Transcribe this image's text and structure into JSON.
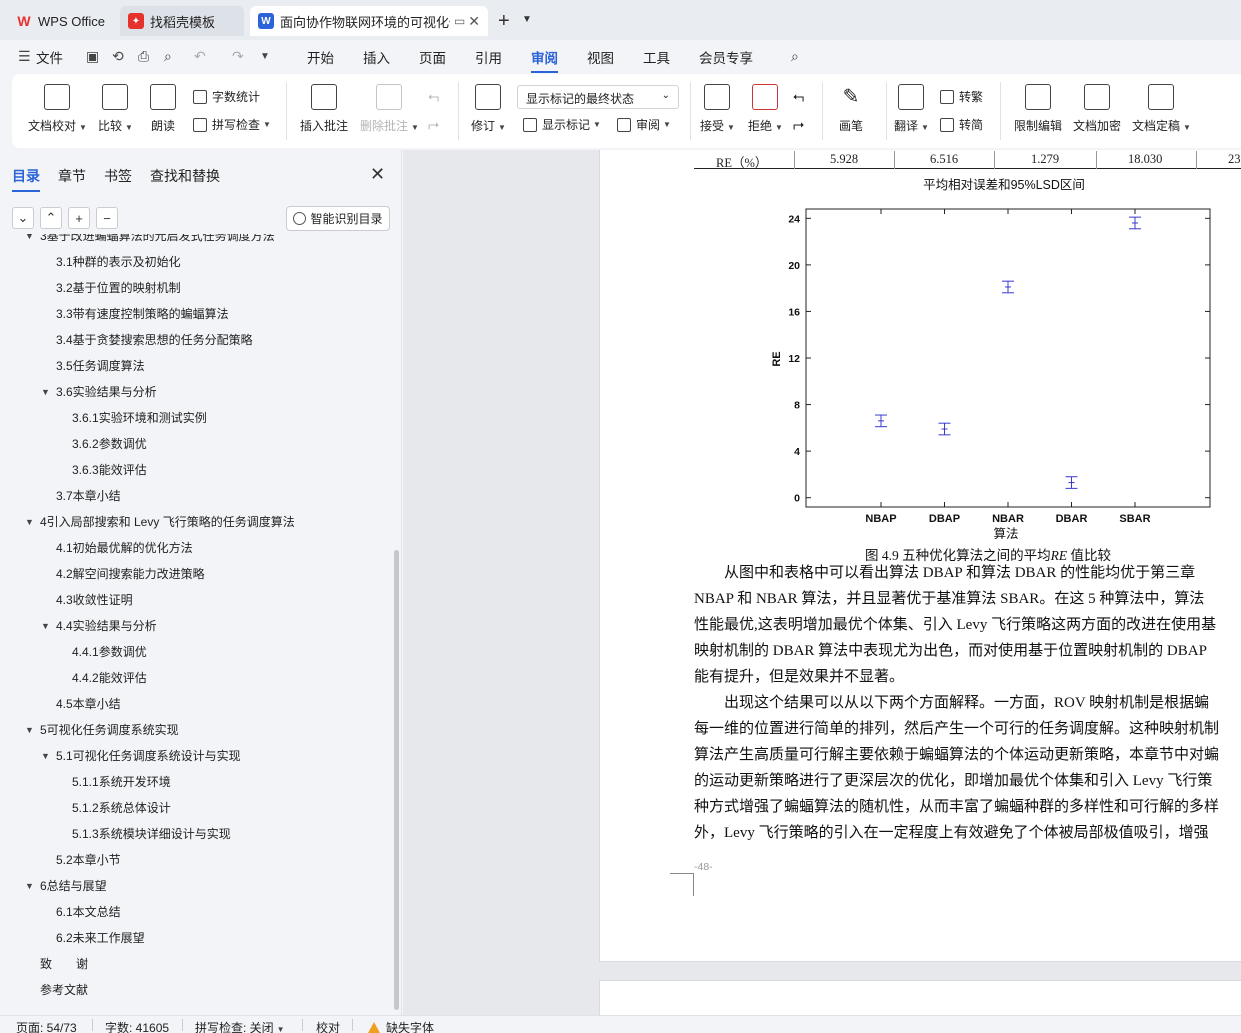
{
  "titlebar": {
    "tabs": [
      {
        "label": "WPS Office"
      },
      {
        "label": "找稻壳模板"
      },
      {
        "label": "面向协作物联网环境的可视化任"
      }
    ]
  },
  "menubar": {
    "file": "文件",
    "items": [
      "开始",
      "插入",
      "页面",
      "引用",
      "审阅",
      "视图",
      "工具",
      "会员专享"
    ],
    "active": "审阅"
  },
  "ribbon": {
    "doc_check": "文档校对",
    "compare": "比较",
    "read_aloud": "朗读",
    "word_count": "字数统计",
    "spell_check": "拼写检查",
    "insert_comment": "插入批注",
    "delete_comment": "删除批注",
    "revise": "修订",
    "markup_state": "显示标记的最终状态",
    "show_markup": "显示标记",
    "review": "审阅",
    "accept": "接受",
    "reject": "拒绝",
    "pen": "画笔",
    "translate": "翻译",
    "to_traditional": "转繁",
    "to_simplified": "转简",
    "restrict_edit": "限制编辑",
    "encrypt": "文档加密",
    "finalize": "文档定稿"
  },
  "sidebar": {
    "tabs": [
      "目录",
      "章节",
      "书签",
      "查找和替换"
    ],
    "smart_toc": "智能识别目录",
    "toc": [
      {
        "label": "3基于改进蝙蝠算法的元启发式任务调度方法",
        "level": 1,
        "arrow": "▼"
      },
      {
        "label": "3.1种群的表示及初始化",
        "level": 2
      },
      {
        "label": "3.2基于位置的映射机制",
        "level": 2
      },
      {
        "label": "3.3带有速度控制策略的蝙蝠算法",
        "level": 2
      },
      {
        "label": "3.4基于贪婪搜索思想的任务分配策略",
        "level": 2
      },
      {
        "label": "3.5任务调度算法",
        "level": 2
      },
      {
        "label": "3.6实验结果与分析",
        "level": 2,
        "arrow": "▼"
      },
      {
        "label": "3.6.1实验环境和测试实例",
        "level": 3
      },
      {
        "label": "3.6.2参数调优",
        "level": 3
      },
      {
        "label": "3.6.3能效评估",
        "level": 3
      },
      {
        "label": "3.7本章小结",
        "level": 2
      },
      {
        "label": "4引入局部搜索和 Levy 飞行策略的任务调度算法",
        "level": 1,
        "arrow": "▼"
      },
      {
        "label": "4.1初始最优解的优化方法",
        "level": 2
      },
      {
        "label": "4.2解空间搜索能力改进策略",
        "level": 2
      },
      {
        "label": "4.3收敛性证明",
        "level": 2
      },
      {
        "label": "4.4实验结果与分析",
        "level": 2,
        "arrow": "▼"
      },
      {
        "label": "4.4.1参数调优",
        "level": 3
      },
      {
        "label": "4.4.2能效评估",
        "level": 3
      },
      {
        "label": "4.5本章小结",
        "level": 2
      },
      {
        "label": "5可视化任务调度系统实现",
        "level": 1,
        "arrow": "▼"
      },
      {
        "label": "5.1可视化任务调度系统设计与实现",
        "level": 2,
        "arrow": "▼"
      },
      {
        "label": "5.1.1系统开发环境",
        "level": 3
      },
      {
        "label": "5.1.2系统总体设计",
        "level": 3
      },
      {
        "label": "5.1.3系统模块详细设计与实现",
        "level": 3
      },
      {
        "label": "5.2本章小节",
        "level": 2
      },
      {
        "label": "6总结与展望",
        "level": 1,
        "arrow": "▼"
      },
      {
        "label": "6.1本文总结",
        "level": 2
      },
      {
        "label": "6.2未来工作展望",
        "level": 2
      },
      {
        "label": "致　　谢",
        "level": 0
      },
      {
        "label": "参考文献",
        "level": 0
      }
    ]
  },
  "document": {
    "table_row": {
      "label": "RE（%）",
      "values": [
        "5.928",
        "6.516",
        "1.279",
        "18.030",
        "23"
      ]
    },
    "caption_prefix": "图 4.9 五种优化算法之间的平均",
    "caption_italic": "RE",
    "caption_suffix": " 值比较",
    "paragraph_lines": [
      "　　从图中和表格中可以看出算法 DBAP 和算法 DBAR 的性能均优于第三章",
      "NBAP 和 NBAR 算法，并且显著优于基准算法 SBAR。在这 5 种算法中，算法",
      "性能最优,这表明增加最优个体集、引入 Levy 飞行策略这两方面的改进在使用基",
      "映射机制的 DBAR 算法中表现尤为出色，而对使用基于位置映射机制的 DBAP",
      "能有提升，但是效果并不显著。",
      "　　出现这个结果可以从以下两个方面解释。一方面，ROV 映射机制是根据蝙",
      "每一维的位置进行简单的排列，然后产生一个可行的任务调度解。这种映射机制",
      "算法产生高质量可行解主要依赖于蝙蝠算法的个体运动更新策略，本章节中对蝙",
      "的运动更新策略进行了更深层次的优化，即增加最优个体集和引入 Levy 飞行策",
      "种方式增强了蝙蝠算法的随机性，从而丰富了蝙蝠种群的多样性和可行解的多样",
      "外，Levy 飞行策略的引入在一定程度上有效避免了个体被局部极值吸引，增强"
    ],
    "page_number": "-48-"
  },
  "chart_data": {
    "type": "scatter",
    "title": "平均相对误差和95%LSD区间",
    "xlabel": "算法",
    "ylabel": "RE",
    "categories": [
      "NBAP",
      "DBAP",
      "NBAR",
      "DBAR",
      "SBAR"
    ],
    "means": [
      6.6,
      5.9,
      18.1,
      1.3,
      23.6
    ],
    "lower": [
      6.1,
      5.4,
      17.6,
      0.8,
      23.1
    ],
    "upper": [
      7.1,
      6.4,
      18.6,
      1.8,
      24.1
    ],
    "yticks": [
      0,
      4,
      8,
      12,
      16,
      20,
      24
    ],
    "ylim": [
      -0.8,
      24.8
    ],
    "color": "#3a3ad0",
    "grid": false
  },
  "statusbar": {
    "page": "页面: 54/73",
    "words": "字数: 41605",
    "spell": "拼写检查: 关闭",
    "proof": "校对",
    "missing_font": "缺失字体"
  }
}
